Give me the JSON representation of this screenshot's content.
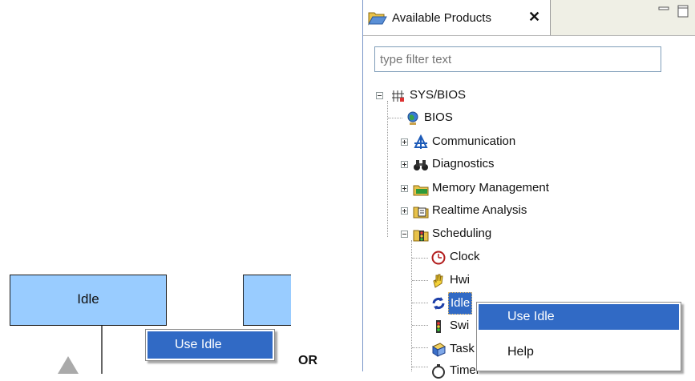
{
  "diagram": {
    "block_label": "Idle",
    "context_menu_item": "Use Idle"
  },
  "or_text": "OR",
  "panel": {
    "tab_title": "Available Products",
    "filter_placeholder": "type filter text",
    "tree": {
      "root": "SYS/BIOS",
      "children": [
        "BIOS",
        "Communication",
        "Diagnostics",
        "Memory Management",
        "Realtime Analysis",
        "Scheduling"
      ],
      "scheduling_children": [
        "Clock",
        "Hwi",
        "Idle",
        "Swi",
        "Task",
        "Timer"
      ]
    },
    "context_menu": {
      "items": [
        "Use Idle",
        "Help"
      ]
    }
  }
}
